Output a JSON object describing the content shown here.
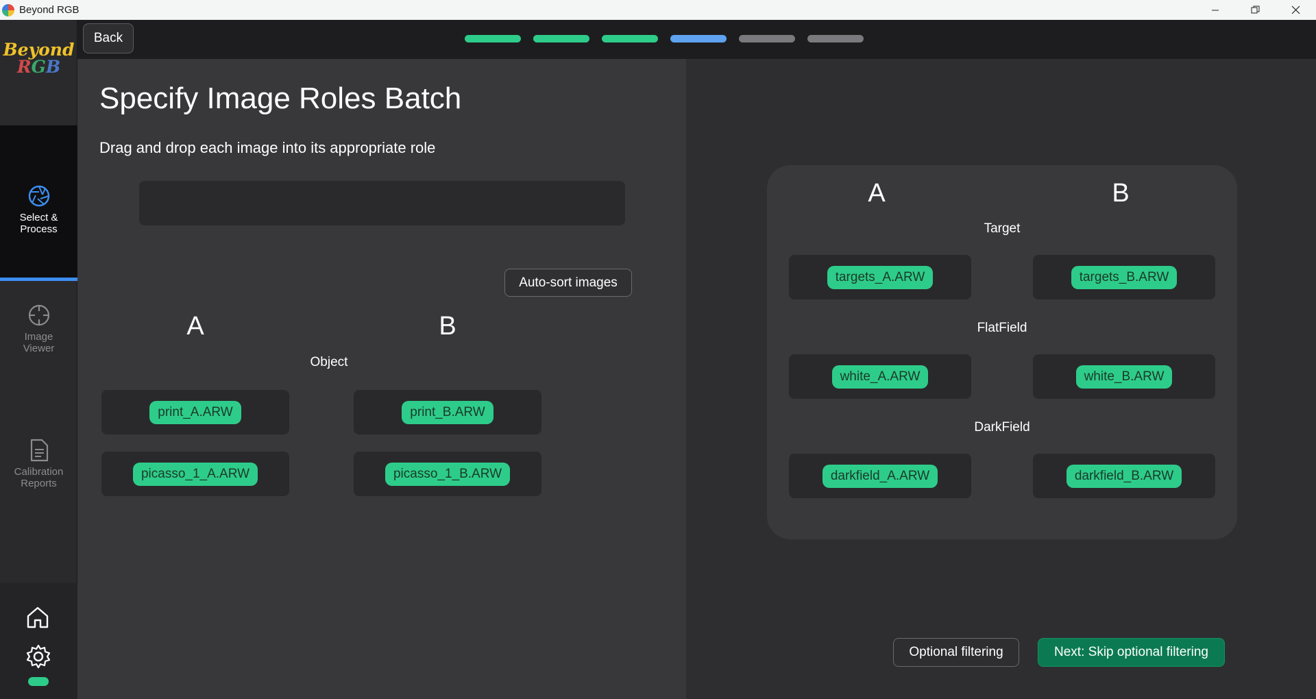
{
  "window": {
    "title": "Beyond RGB",
    "controls": [
      "minimize",
      "restore",
      "close"
    ]
  },
  "logo": {
    "line1": "Beyond",
    "line2": "RGB"
  },
  "sidebar": {
    "items": [
      {
        "label_line1": "Select &",
        "label_line2": "Process",
        "icon": "aperture-icon",
        "active": true
      },
      {
        "label_line1": "Image",
        "label_line2": "Viewer",
        "icon": "crosshair-icon",
        "active": false
      },
      {
        "label_line1": "Calibration",
        "label_line2": "Reports",
        "icon": "document-icon",
        "active": false
      }
    ],
    "bottom_icons": [
      "home-icon",
      "gear-icon"
    ]
  },
  "header": {
    "back_label": "Back",
    "progress": {
      "total_steps": 6,
      "completed": 3,
      "current": 4
    }
  },
  "left": {
    "title": "Specify Image Roles Batch",
    "subtitle": "Drag and drop each image into its appropriate role",
    "autosort_label": "Auto-sort images",
    "col_a": "A",
    "col_b": "B",
    "object_label": "Object",
    "object_rows": [
      {
        "a": "print_A.ARW",
        "b": "print_B.ARW"
      },
      {
        "a": "picasso_1_A.ARW",
        "b": "picasso_1_B.ARW"
      }
    ]
  },
  "right": {
    "col_a": "A",
    "col_b": "B",
    "roles": [
      {
        "label": "Target",
        "a": "targets_A.ARW",
        "b": "targets_B.ARW"
      },
      {
        "label": "FlatField",
        "a": "white_A.ARW",
        "b": "white_B.ARW"
      },
      {
        "label": "DarkField",
        "a": "darkfield_A.ARW",
        "b": "darkfield_B.ARW"
      }
    ],
    "optional_label": "Optional filtering",
    "next_label": "Next: Skip optional filtering"
  },
  "colors": {
    "accent_green": "#2ecc8a",
    "accent_blue": "#3d8ef0",
    "next_button": "#0b7a52",
    "inactive_step": "#7a7a7e"
  }
}
